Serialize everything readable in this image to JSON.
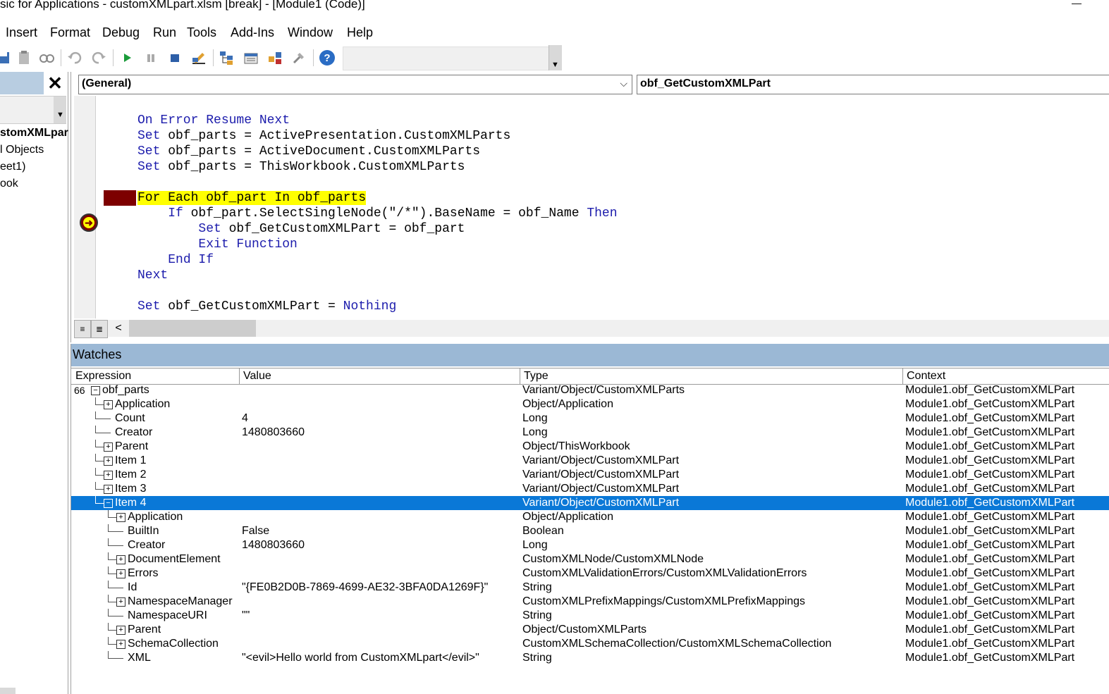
{
  "window": {
    "title": "sic for Applications - customXMLpart.xlsm [break] - [Module1 (Code)]",
    "minimize_glyph": "—"
  },
  "menubar": {
    "items": [
      "Insert",
      "Format",
      "Debug",
      "Run",
      "Tools",
      "Add-Ins",
      "Window",
      "Help"
    ]
  },
  "toolbar": {
    "icons": [
      "save-icon",
      "paste-icon",
      "find-icon",
      "undo-icon",
      "redo-icon",
      "run-icon",
      "break-icon",
      "reset-icon",
      "design-mode-icon",
      "project-explorer-icon",
      "properties-icon",
      "object-browser-icon",
      "toolbox-icon",
      "help-icon"
    ],
    "grip_glyph": "▼"
  },
  "project": {
    "close_glyph": "✕",
    "scroll_glyph": "▼",
    "nodes": [
      "stomXMLpar",
      "l Objects",
      "eet1)",
      "ook"
    ]
  },
  "code": {
    "object_combo": "(General)",
    "object_combo_arrow": "⌵",
    "procedure_combo": "obf_GetCustomXMLPart",
    "lines": [
      {
        "indent": "",
        "parts": [
          {
            "t": "On Error Resume Next",
            "k": true
          }
        ]
      },
      {
        "indent": "",
        "parts": [
          {
            "t": "Set",
            "k": true
          },
          {
            "t": " obf_parts = ActivePresentation.CustomXMLParts",
            "k": false
          }
        ]
      },
      {
        "indent": "",
        "parts": [
          {
            "t": "Set",
            "k": true
          },
          {
            "t": " obf_parts = ActiveDocument.CustomXMLParts",
            "k": false
          }
        ]
      },
      {
        "indent": "",
        "parts": [
          {
            "t": "Set",
            "k": true
          },
          {
            "t": " obf_parts = ThisWorkbook.CustomXMLParts",
            "k": false
          }
        ]
      },
      {
        "indent": "",
        "parts": []
      },
      {
        "indent": "",
        "parts": [
          {
            "t": "For Each obf_part In obf_parts",
            "k": false,
            "hl": true
          }
        ]
      },
      {
        "indent": "    ",
        "parts": [
          {
            "t": "If",
            "k": true
          },
          {
            "t": " obf_part.SelectSingleNode(\"/*\").BaseName = obf_Name ",
            "k": false
          },
          {
            "t": "Then",
            "k": true
          }
        ]
      },
      {
        "indent": "        ",
        "parts": [
          {
            "t": "Set",
            "k": true
          },
          {
            "t": " obf_GetCustomXMLPart = obf_part",
            "k": false
          }
        ]
      },
      {
        "indent": "        ",
        "parts": [
          {
            "t": "Exit Function",
            "k": true
          }
        ]
      },
      {
        "indent": "    ",
        "parts": [
          {
            "t": "End If",
            "k": true
          }
        ]
      },
      {
        "indent": "",
        "parts": [
          {
            "t": "Next",
            "k": true
          }
        ]
      },
      {
        "indent": "",
        "parts": []
      },
      {
        "indent": "",
        "parts": [
          {
            "t": "Set",
            "k": true
          },
          {
            "t": " obf_GetCustomXMLPart = ",
            "k": false
          },
          {
            "t": "Nothing",
            "k": true
          }
        ]
      }
    ],
    "view_procedure_glyph": "≡",
    "view_full_glyph": "≣",
    "scroll_left_glyph": "<"
  },
  "watches": {
    "title": "Watches",
    "columns": [
      "Expression",
      "Value",
      "Type",
      "Context"
    ],
    "watch_glyph": "66",
    "rows": [
      {
        "level": 0,
        "toggle": "−",
        "expr": "obf_parts",
        "value": "",
        "type": "Variant/Object/CustomXMLParts",
        "context": "Module1.obf_GetCustomXMLPart",
        "watch": true
      },
      {
        "level": 1,
        "toggle": "+",
        "expr": "Application",
        "value": "",
        "type": "Object/Application",
        "context": "Module1.obf_GetCustomXMLPart"
      },
      {
        "level": 1,
        "toggle": "",
        "expr": "Count",
        "value": "4",
        "type": "Long",
        "context": "Module1.obf_GetCustomXMLPart"
      },
      {
        "level": 1,
        "toggle": "",
        "expr": "Creator",
        "value": "1480803660",
        "type": "Long",
        "context": "Module1.obf_GetCustomXMLPart"
      },
      {
        "level": 1,
        "toggle": "+",
        "expr": "Parent",
        "value": "",
        "type": "Object/ThisWorkbook",
        "context": "Module1.obf_GetCustomXMLPart"
      },
      {
        "level": 1,
        "toggle": "+",
        "expr": "Item 1",
        "value": "",
        "type": "Variant/Object/CustomXMLPart",
        "context": "Module1.obf_GetCustomXMLPart"
      },
      {
        "level": 1,
        "toggle": "+",
        "expr": "Item 2",
        "value": "",
        "type": "Variant/Object/CustomXMLPart",
        "context": "Module1.obf_GetCustomXMLPart"
      },
      {
        "level": 1,
        "toggle": "+",
        "expr": "Item 3",
        "value": "",
        "type": "Variant/Object/CustomXMLPart",
        "context": "Module1.obf_GetCustomXMLPart"
      },
      {
        "level": 1,
        "toggle": "−",
        "expr": "Item 4",
        "value": "",
        "type": "Variant/Object/CustomXMLPart",
        "context": "Module1.obf_GetCustomXMLPart",
        "selected": true
      },
      {
        "level": 2,
        "toggle": "+",
        "expr": "Application",
        "value": "",
        "type": "Object/Application",
        "context": "Module1.obf_GetCustomXMLPart"
      },
      {
        "level": 2,
        "toggle": "",
        "expr": "BuiltIn",
        "value": "False",
        "type": "Boolean",
        "context": "Module1.obf_GetCustomXMLPart"
      },
      {
        "level": 2,
        "toggle": "",
        "expr": "Creator",
        "value": "1480803660",
        "type": "Long",
        "context": "Module1.obf_GetCustomXMLPart"
      },
      {
        "level": 2,
        "toggle": "+",
        "expr": "DocumentElement",
        "value": "",
        "type": "CustomXMLNode/CustomXMLNode",
        "context": "Module1.obf_GetCustomXMLPart"
      },
      {
        "level": 2,
        "toggle": "+",
        "expr": "Errors",
        "value": "",
        "type": "CustomXMLValidationErrors/CustomXMLValidationErrors",
        "context": "Module1.obf_GetCustomXMLPart"
      },
      {
        "level": 2,
        "toggle": "",
        "expr": "Id",
        "value": "\"{FE0B2D0B-7869-4699-AE32-3BFA0DA1269F}\"",
        "type": "String",
        "context": "Module1.obf_GetCustomXMLPart"
      },
      {
        "level": 2,
        "toggle": "+",
        "expr": "NamespaceManager",
        "value": "",
        "type": "CustomXMLPrefixMappings/CustomXMLPrefixMappings",
        "context": "Module1.obf_GetCustomXMLPart"
      },
      {
        "level": 2,
        "toggle": "",
        "expr": "NamespaceURI",
        "value": "\"\"",
        "type": "String",
        "context": "Module1.obf_GetCustomXMLPart"
      },
      {
        "level": 2,
        "toggle": "+",
        "expr": "Parent",
        "value": "",
        "type": "Object/CustomXMLParts",
        "context": "Module1.obf_GetCustomXMLPart"
      },
      {
        "level": 2,
        "toggle": "+",
        "expr": "SchemaCollection",
        "value": "",
        "type": "CustomXMLSchemaCollection/CustomXMLSchemaCollection",
        "context": "Module1.obf_GetCustomXMLPart"
      },
      {
        "level": 2,
        "toggle": "",
        "expr": "XML",
        "value": "\"<evil>Hello world from CustomXMLpart</evil>\"",
        "type": "String",
        "context": "Module1.obf_GetCustomXMLPart"
      }
    ]
  },
  "colors": {
    "keyword": "#1c1cac",
    "highlight": "#ffff00",
    "breakpoint": "#7d0000",
    "selection": "#0a78d7",
    "pane_title": "#9bb8d5"
  }
}
